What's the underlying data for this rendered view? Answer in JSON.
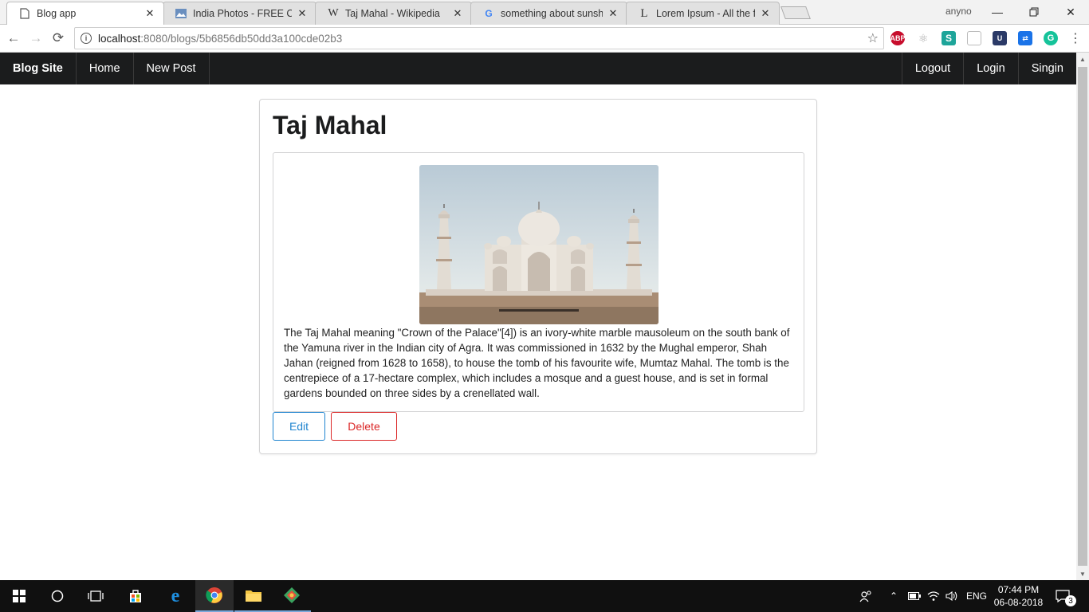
{
  "browser": {
    "tabs": [
      {
        "title": "Blog app",
        "favicon": "page-icon",
        "active": true
      },
      {
        "title": "India Photos - FREE Creat",
        "favicon": "photos-icon",
        "active": false
      },
      {
        "title": "Taj Mahal - Wikipedia",
        "favicon": "wikipedia-icon",
        "active": false
      },
      {
        "title": "something about sunshin",
        "favicon": "google-icon",
        "active": false
      },
      {
        "title": "Lorem Ipsum - All the fac",
        "favicon": "lipsum-icon",
        "active": false
      }
    ],
    "profile_name": "anyno",
    "url_host": "localhost",
    "url_path": ":8080/blogs/5b6856db50dd3a100cde02b3",
    "extensions": [
      "ABP"
    ]
  },
  "navbar": {
    "brand": "Blog Site",
    "left_items": [
      "Home",
      "New Post"
    ],
    "right_items": [
      "Logout",
      "Login",
      "Singin"
    ]
  },
  "post": {
    "title": "Taj Mahal",
    "body": "The Taj Mahal meaning \"Crown of the Palace\"[4]) is an ivory-white marble mausoleum on the south bank of the Yamuna river in the Indian city of Agra. It was commissioned in 1632 by the Mughal emperor, Shah Jahan (reigned from 1628 to 1658), to house the tomb of his favourite wife, Mumtaz Mahal. The tomb is the centrepiece of a 17-hectare complex, which includes a mosque and a guest house, and is set in formal gardens bounded on three sides by a crenellated wall.",
    "edit_label": "Edit",
    "delete_label": "Delete",
    "colors": {
      "edit": "#2185d0",
      "delete": "#db2828"
    }
  },
  "taskbar": {
    "language": "ENG",
    "time": "07:44 PM",
    "date": "06-08-2018",
    "notification_count": "3"
  }
}
